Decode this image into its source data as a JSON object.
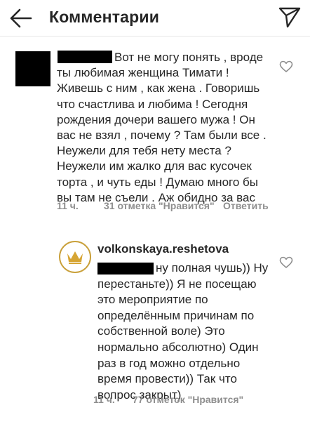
{
  "header": {
    "title": "Комментарии",
    "back_icon": "arrow-left-icon",
    "send_icon": "paper-plane-icon"
  },
  "comments": [
    {
      "username": "",
      "text": "Вот не могу понять , вроде ты любимая женщина Тимати ! Живешь с ним , как жена . Говоришь что счастлива и любима ! Сегодня рождения дочери вашего мужа ! Он вас не взял , почему ? Там были все . Неужели для тебя нету места ? Неужели им жалко для вас кусочек торта , и чуть еды ! Думаю много бы вы там не съели . Аж обидно за вас",
      "time": "11 ч.",
      "likes": "31 отметка \"Нравится\"",
      "reply": "Ответить"
    },
    {
      "username": "volkonskaya.reshetova",
      "text": "ну полная чушь)) Ну перестаньте)) Я не посещаю это мероприятие по определённым причинам по собственной воле) Это нормально абсолютно) Один раз в год можно отдельно время провести)) Так что вопрос закрыт)",
      "time": "11 ч.",
      "likes": "77 отметок \"Нравится\""
    }
  ]
}
